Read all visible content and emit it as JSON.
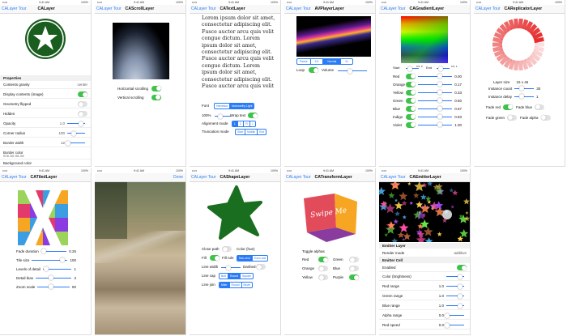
{
  "status": {
    "carrier": "•••••",
    "time": "9:41 AM",
    "battery": "100%"
  },
  "s1": {
    "back": "CALayer Tour",
    "title": "CALayer",
    "section": "Properties",
    "rows": [
      {
        "label": "Contents gravity",
        "value": "center"
      },
      {
        "label": "Display contents (image)"
      },
      {
        "label": "Geometry flipped"
      },
      {
        "label": "Hidden"
      },
      {
        "label": "Opacity",
        "value": "1.0"
      },
      {
        "label": "Corner radius",
        "value": "100"
      },
      {
        "label": "Border width",
        "value": "12"
      },
      {
        "label": "Border color",
        "sub": "RGB 255 255 255"
      },
      {
        "label": "Background color"
      }
    ]
  },
  "s2": {
    "back": "CALayer Tour",
    "title": "CAScrollLayer",
    "h": "Horizontal scrolling",
    "v": "Vertical scrolling"
  },
  "s3": {
    "back": "CALayer Tour",
    "title": "CATextLayer",
    "text": "Lorem ipsum dolor sit amet, consectetur adipiscing elit. Fusce auctor arcu quis velit congue dictum. Lorem ipsum dolor sit amet, consectetur adipiscing elit. Fusce auctor arcu quis velit congue dictum. Lorem ipsum dolor sit amet, consectetur adipiscing elit. Fusce auctor arcu quis velit",
    "font": "Font",
    "fonts": [
      "Helvetica",
      "Noteworthy Light"
    ],
    "size": "100%",
    "wrap": "Wrap text",
    "align": "Alignment mode",
    "aligns": [
      "L",
      "C",
      "R",
      "J"
    ],
    "trunc": "Truncation mode",
    "truncs": [
      "Start",
      "Middle",
      "End"
    ]
  },
  "s4": {
    "back": "CALayer Tour",
    "title": "AVPlayerLayer",
    "rates": [
      "Pause",
      "1/4",
      "Normal",
      "2x"
    ],
    "loop": "Loop",
    "volume": "Volume"
  },
  "s5": {
    "back": "CALayer Tour",
    "title": "CAGradientLayer",
    "start": "Start",
    "end": "End",
    "sv": "0.5, 0",
    "ev": "0.5, 1",
    "rows": [
      {
        "label": "Red",
        "value": "0.00"
      },
      {
        "label": "Orange",
        "value": "0.17"
      },
      {
        "label": "Yellow",
        "value": "0.33"
      },
      {
        "label": "Green",
        "value": "0.50"
      },
      {
        "label": "Blue",
        "value": "0.67"
      },
      {
        "label": "Indigo",
        "value": "0.83"
      },
      {
        "label": "Violet",
        "value": "1.00"
      }
    ]
  },
  "s6": {
    "back": "CALayer Tour",
    "title": "CAReplicatorLayer",
    "rows": [
      {
        "label": "Layer size",
        "value": "15 x 46"
      },
      {
        "label": "Instance count",
        "value": "30"
      },
      {
        "label": "Instance delay",
        "value": "1"
      }
    ],
    "t1": "Fade red",
    "t2": "Fade blue",
    "t3": "Fade green",
    "t4": "Fade alpha"
  },
  "s7": {
    "back": "CALayer Tour",
    "title": "CATiledLayer",
    "rows": [
      {
        "label": "Fade duration",
        "value": "0.25"
      },
      {
        "label": "Tile size",
        "value": "100"
      },
      {
        "label": "Levels of detail",
        "value": "1"
      },
      {
        "label": "Detail bias",
        "value": "3"
      },
      {
        "label": "Zoom scale",
        "value": "50"
      }
    ]
  },
  "s8": {
    "done": "Done"
  },
  "s9": {
    "back": "CALayer Tour",
    "title": "CAShapeLayer",
    "close": "Close path",
    "color": "Color (hue)",
    "fill": "Fill",
    "rule": "Fill rule",
    "rules": [
      "Non-zero",
      "Even odd"
    ],
    "lw": "Line width",
    "dashed": "Dashed",
    "cap": "Line cap",
    "caps": [
      "Butt",
      "Round",
      "Square"
    ],
    "join": "Line join",
    "joins": [
      "Miter",
      "Round",
      "Bevel"
    ]
  },
  "s10": {
    "back": "CALayer Tour",
    "title": "CATransformLayer",
    "swipe": "Swipe Me",
    "toggle": "Toggle alphas",
    "labels": [
      "Red",
      "Green",
      "Orange",
      "Blue",
      "Yellow",
      "Purple"
    ]
  },
  "s11": {
    "back": "CALayer Tour",
    "title": "CAEmitterLayer",
    "sec1": "Emitter Layer",
    "render": "Render mode",
    "renderv": "additive",
    "sec2": "Emitter Cell",
    "enabled": "Enabled",
    "rows": [
      {
        "label": "Color (brightness)",
        "value": ""
      },
      {
        "label": "Red range",
        "value": "1.0"
      },
      {
        "label": "Green range",
        "value": "1.0"
      },
      {
        "label": "Blue range",
        "value": "1.0"
      },
      {
        "label": "Alpha range",
        "value": "0.0"
      },
      {
        "label": "Red speed",
        "value": "0.0"
      }
    ]
  },
  "colors": {
    "accent": "#2a7cf6",
    "toggle": "#3ec34a",
    "forest": "#1a5e1f"
  }
}
